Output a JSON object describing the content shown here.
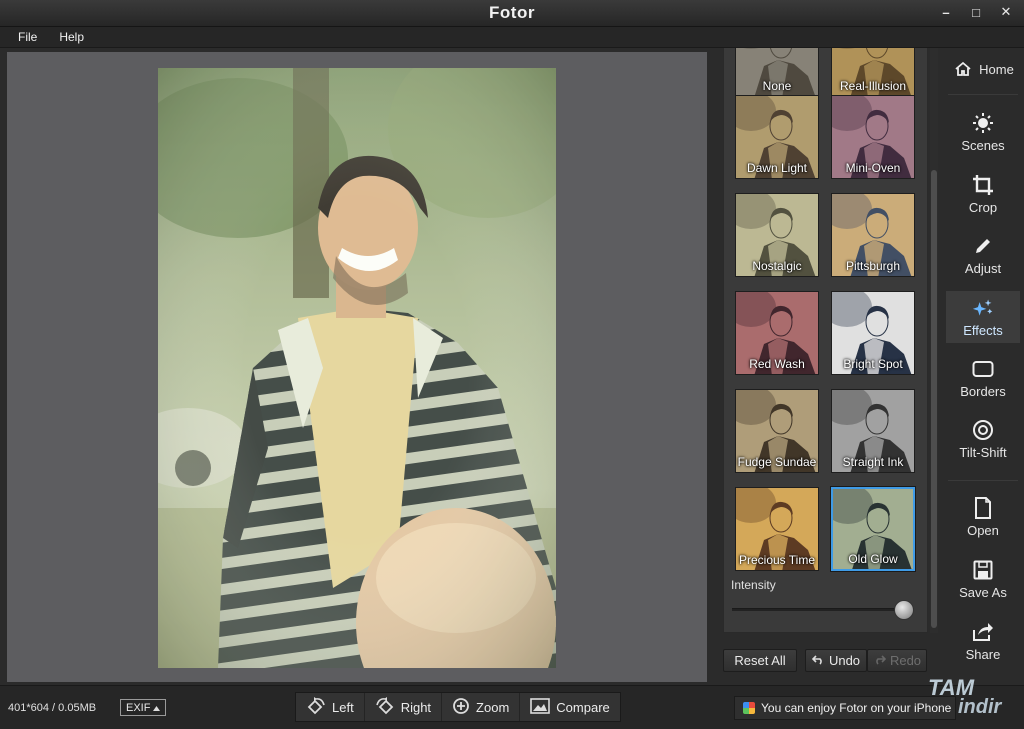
{
  "window": {
    "title": "Fotor",
    "controls": [
      "–",
      "□",
      "✕"
    ]
  },
  "menu": {
    "items": [
      "File",
      "Help"
    ]
  },
  "effects": {
    "thumbnails": [
      {
        "label": "None",
        "tint": "#9a9588",
        "tone": "#5a5448"
      },
      {
        "label": "Real-Illusion",
        "tint": "#c9a765",
        "tone": "#6a5230"
      },
      {
        "label": "Dawn Light",
        "tint": "#c9b27e",
        "tone": "#5a4a3a"
      },
      {
        "label": "Mini-Oven",
        "tint": "#b88a9a",
        "tone": "#4a3348"
      },
      {
        "label": "Nostalgic",
        "tint": "#d6d2a8",
        "tone": "#5e5d48"
      },
      {
        "label": "Pittsburgh",
        "tint": "#e8c48a",
        "tone": "#4c5a72"
      },
      {
        "label": "Red Wash",
        "tint": "#c27b7d",
        "tone": "#4a2c34"
      },
      {
        "label": "Bright Spot",
        "tint": "#ffffff",
        "tone": "#2d3a50"
      },
      {
        "label": "Fudge Sundae",
        "tint": "#c8b38a",
        "tone": "#4a3e2e"
      },
      {
        "label": "Straight Ink",
        "tint": "#b8b8b8",
        "tone": "#3a3a3a"
      },
      {
        "label": "Precious Time",
        "tint": "#f2c066",
        "tone": "#6a4428"
      },
      {
        "label": "Old Glow",
        "tint": "#b9c7a6",
        "tone": "#2e3a3a"
      }
    ],
    "selected_index": 11,
    "intensity_label": "Intensity",
    "intensity_value": 1.0,
    "reset_label": "Reset All",
    "undo_label": "Undo",
    "redo_label": "Redo"
  },
  "nav": {
    "home": "Home",
    "scenes": "Scenes",
    "crop": "Crop",
    "adjust": "Adjust",
    "effects": "Effects",
    "borders": "Borders",
    "tiltshift": "Tilt-Shift",
    "open": "Open",
    "saveas": "Save As",
    "share": "Share"
  },
  "status": {
    "dims": "401*604 / 0.05MB",
    "exif": "EXIF",
    "tools": {
      "left": "Left",
      "right": "Right",
      "zoom": "Zoom",
      "compare": "Compare"
    },
    "promo": "You can enjoy Fotor on your iPhone"
  },
  "watermark": {
    "top": "TAM",
    "bottom": "indir"
  },
  "colors": {
    "accent": "#3f9be6",
    "panel": "#3a3a3a",
    "canvas": "#5d5d60"
  }
}
